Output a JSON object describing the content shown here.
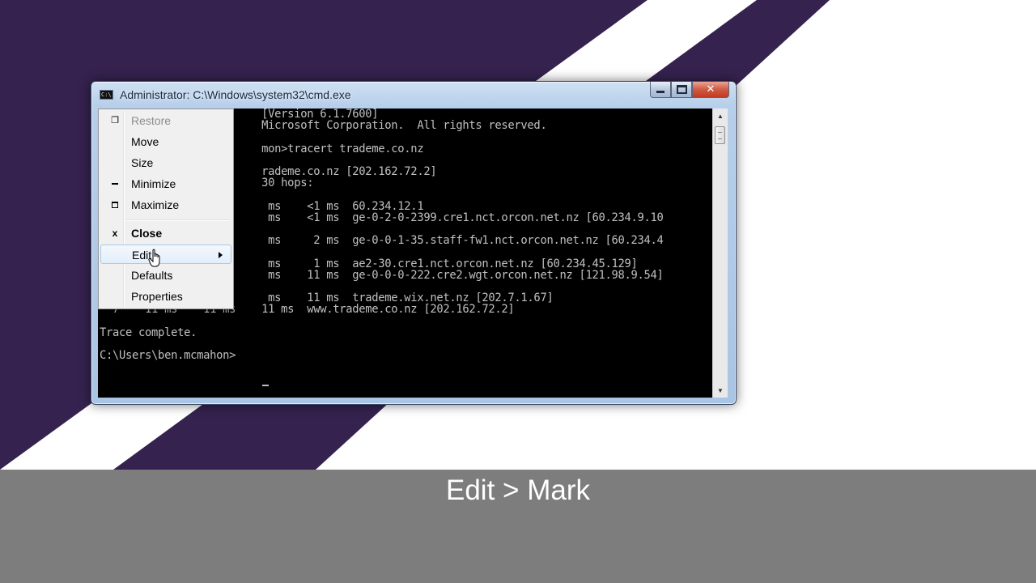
{
  "window": {
    "title": "Administrator: C:\\Windows\\system32\\cmd.exe",
    "icon": "cmd-icon",
    "icon_text": "C:\\"
  },
  "console": {
    "lines": [
      "                         [Version 6.1.7600]",
      "                         Microsoft Corporation.  All rights reserved.",
      "",
      "                         mon>tracert trademe.co.nz",
      "",
      "                         rademe.co.nz [202.162.72.2]",
      "                         30 hops:",
      "",
      "                          ms    <1 ms  60.234.12.1",
      "                          ms    <1 ms  ge-0-2-0-2399.cre1.nct.orcon.net.nz [60.234.9.10",
      "",
      "                          ms     2 ms  ge-0-0-1-35.staff-fw1.nct.orcon.net.nz [60.234.4",
      "",
      "                          ms     1 ms  ae2-30.cre1.nct.orcon.net.nz [60.234.45.129]",
      "                          ms    11 ms  ge-0-0-0-222.cre2.wgt.orcon.net.nz [121.98.9.54]",
      "",
      "                          ms    11 ms  trademe.wix.net.nz [202.7.1.67]",
      "  7    11 ms    11 ms    11 ms  www.trademe.co.nz [202.162.72.2]",
      "",
      "Trace complete.",
      "",
      "C:\\Users\\ben.mcmahon>"
    ]
  },
  "system_menu": {
    "items": [
      {
        "label": "Restore",
        "icon": "restore-icon",
        "state": "disabled"
      },
      {
        "label": "Move"
      },
      {
        "label": "Size"
      },
      {
        "label": "Minimize",
        "icon": "minimize-icon"
      },
      {
        "label": "Maximize",
        "icon": "maximize-icon"
      },
      {
        "label": "Close",
        "icon": "close-icon",
        "bold": true
      },
      {
        "label": "Edit",
        "state": "highlighted",
        "submenu": true
      },
      {
        "label": "Defaults"
      },
      {
        "label": "Properties"
      }
    ]
  },
  "caption": "Edit > Mark",
  "colors": {
    "console_bg": "#000000",
    "console_text": "#c0c0c0",
    "background_purple": "#35224f",
    "caption_bar": "#7d7d7d"
  }
}
